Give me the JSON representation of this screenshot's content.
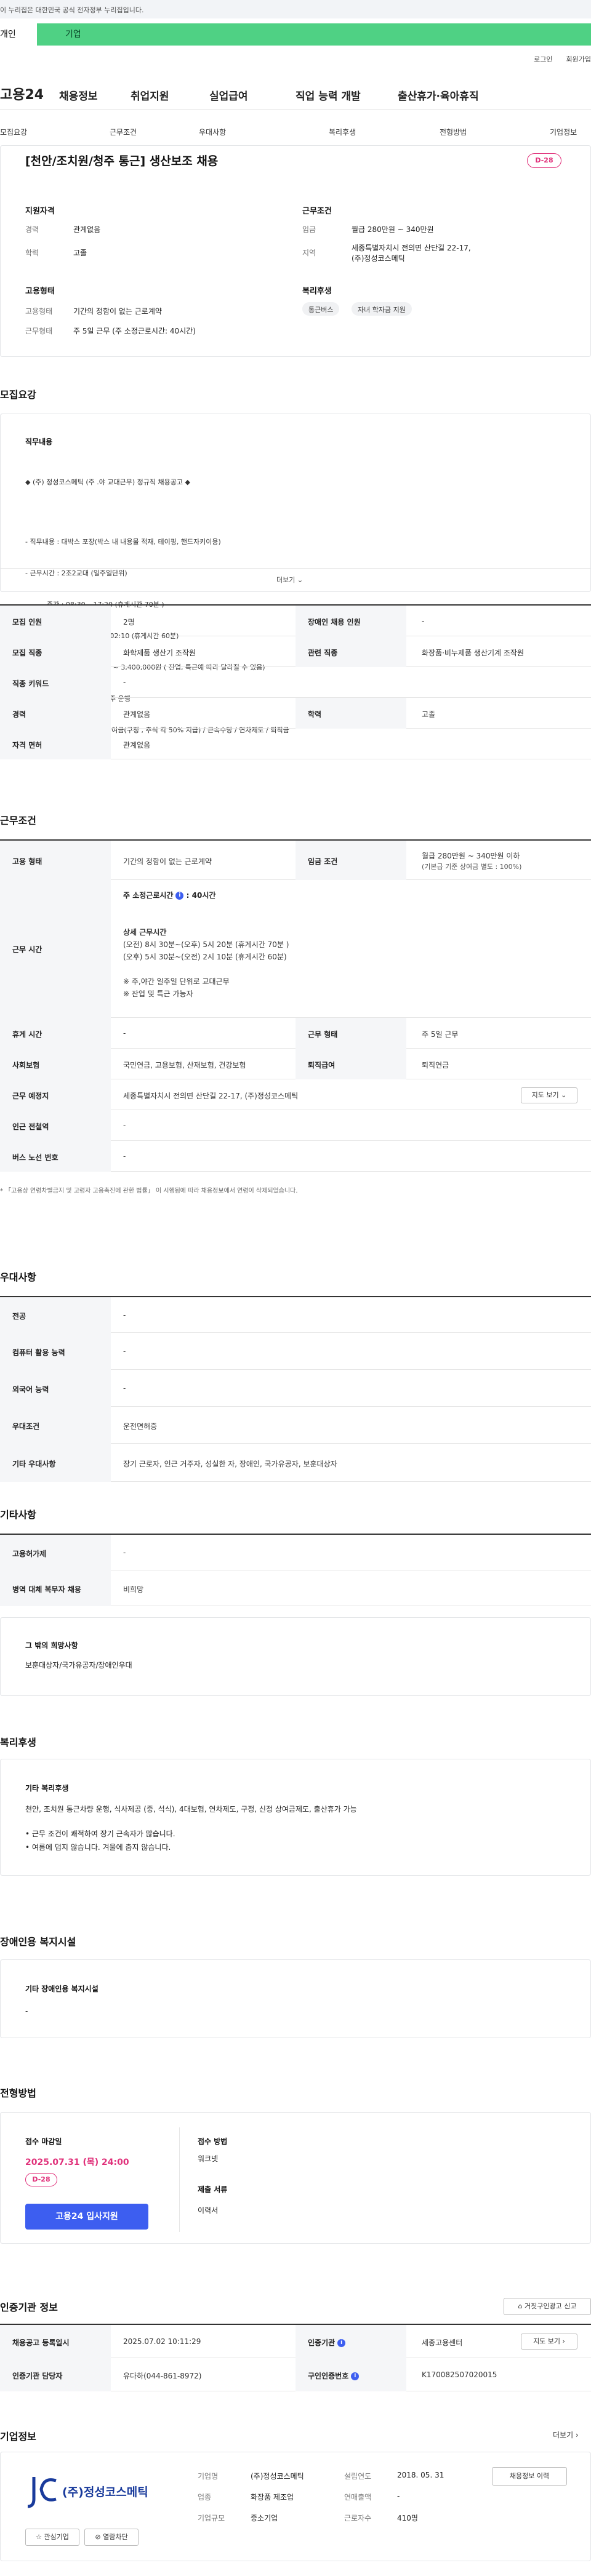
{
  "banner": {
    "text": "이 누리집은 대한민국 공식 전자정부 누리집입니다."
  },
  "user_tabs": [
    "개인",
    "기업"
  ],
  "top_links": [
    "로그인",
    "회원가입"
  ],
  "gnb": {
    "logo": "고용24",
    "items": [
      "채용정보",
      "취업지원",
      "실업급여",
      "직업 능력 개발",
      "출산휴가·육아휴직"
    ]
  },
  "subnav": [
    "모집요강",
    "근무조건",
    "우대사항",
    "복리후생",
    "전형방법",
    "기업정보"
  ],
  "header": {
    "title": "[천안/조치원/청주 통근] 생산보조 채용",
    "dday": "D-28",
    "qualification": {
      "label": "지원자격",
      "rows": [
        {
          "k": "경력",
          "v": "관계없음"
        },
        {
          "k": "학력",
          "v": "고졸"
        }
      ]
    },
    "conditions": {
      "label": "근무조건",
      "rows": [
        {
          "k": "임금",
          "v": "월급 280만원 ~ 340만원"
        },
        {
          "k": "지역",
          "v": "세종특별자치시 전의면 산단길 22-17, (주)정성코스메틱"
        }
      ]
    },
    "employment": {
      "label": "고용형태",
      "rows": [
        {
          "k": "고용형태",
          "v": "기간의 정함이 없는 근로계약"
        },
        {
          "k": "근무형태",
          "v": "주 5일 근무 (주 소정근로시간: 40시간)"
        }
      ]
    },
    "welfare": {
      "label": "복리후생",
      "chips": [
        "통근버스",
        "자녀 학자금 지원"
      ]
    }
  },
  "recruit": {
    "section_title": "모집요강",
    "duty_label": "직무내용",
    "duty_lines": [
      "◆ (주) 정성코스메틱 (주 .야 교대근무) 정규직 채용공고 ◆",
      "- 직무내용 : 대박스 포장(박스 내 내용물 적재, 테이핑, 핸드자키이용)",
      "- 근무시간 : 2조2교대 (일주일단위)",
      "          주간 : 08:30 ~17:20 (휴게시간 70분 )",
      "          야간 : 17:30 ~ 익일 02:10 (휴게시간 60분)",
      "- 급      여 : 월급 2,800,000 ~ 3,400,000원 ( 잔업, 특근에 따라 달라질 수 있음)",
      "- 통근버스 : 천안 , 조치원, 청주 운행",
      "- 복리후생 : 식사제공 / 명절상여금(구정 , 추석 각 50% 지급) / 근속수당 / 연차제도 / 퇴직금"
    ],
    "more": "더보기",
    "table": [
      {
        "th": "모집 인원",
        "td": "2명",
        "th2": "장애인 채용 인원",
        "td2": "-"
      },
      {
        "th": "모집 직종",
        "td": "화학제품 생산기 조작원",
        "th2": "관련 직종",
        "td2": "화장품·비누제품 생산기계 조작원"
      },
      {
        "th": "직종 키워드",
        "td": "-"
      },
      {
        "th": "경력",
        "td": "관계없음",
        "th2": "학력",
        "td2": "고졸"
      },
      {
        "th": "자격 면허",
        "td": "관계없음"
      }
    ]
  },
  "conditions": {
    "section_title": "근무조건",
    "employment_type": {
      "th": "고용 형태",
      "td": "기간의 정함이 없는 근로계약",
      "th2": "임금 조건",
      "td2a": "월급 280만원 ~ 340만원 이하",
      "td2b": "(기본급 기준 상여금 별도 : 100%)"
    },
    "hours": {
      "th": "근무 시간",
      "weekly": "주 소정근로시간",
      "weekly_value": ": 40시간",
      "detail_title": "상세 근무시간",
      "lines": [
        "(오전) 8시 30분~(오후) 5시 20분 (휴게시간 70분 )",
        "(오후) 5시 30분~(오전) 2시 10분 (휴게시간 60분)"
      ],
      "notes": [
        "※ 주,야간 일주일 단위로 교대근무",
        "※ 잔업 및 특근 가능자"
      ]
    },
    "rows": [
      {
        "th": "휴게 시간",
        "td": "-",
        "th2": "근무 형태",
        "td2": "주 5일 근무"
      },
      {
        "th": "사회보험",
        "td": "국민연금, 고용보험, 산재보험, 건강보험",
        "th2": "퇴직급여",
        "td2": "퇴직연금"
      },
      {
        "th": "근무 예정지",
        "td": "세종특별자치시 전의면 산단길 22-17, (주)정성코스메틱",
        "btn": "지도 보기 ⌄"
      },
      {
        "th": "인근 전철역",
        "td": "-"
      },
      {
        "th": "버스 노선 번호",
        "td": "-"
      }
    ],
    "footnote": "* 「고용상 연령차별금지 및 고령자 고용촉진에 관한 법률」 이 시행됨에 따라 채용정보에서 연령이 삭제되었습니다."
  },
  "preference": {
    "section_title": "우대사항",
    "rows": [
      {
        "th": "전공",
        "td": "-"
      },
      {
        "th": "컴퓨터 활용 능력",
        "td": "-"
      },
      {
        "th": "외국어 능력",
        "td": "-"
      },
      {
        "th": "우대조건",
        "td": "운전면허증"
      },
      {
        "th": "기타 우대사항",
        "td": "장기 근로자, 인근 거주자, 성실한 자, 장애인, 국가유공자, 보훈대상자"
      }
    ]
  },
  "other": {
    "section_title": "기타사항",
    "rows": [
      {
        "th": "고용허가제",
        "td": "-"
      },
      {
        "th": "병역 대체 복무자 채용",
        "td": "비희망"
      }
    ],
    "hope_label": "그 밖의 희망사항",
    "hope_text": "보훈대상자/국가유공자/장애인우대"
  },
  "welfare": {
    "section_title": "복리후생",
    "label": "기타 복리후생",
    "text": "천안, 조치원 통근차량 운행, 식사제공 (중, 석식), 4대보험, 연차제도, 구정, 신정 상여금제도, 출산휴가 가능",
    "bullets": [
      "• 근무 조건이 쾌적하여 장기 근속자가 많습니다.",
      "• 여름에 덥지 않습니다. 겨울에 춥지 않습니다."
    ]
  },
  "disability": {
    "section_title": "장애인용 복지시설",
    "label": "기타 장애인용 복지시설",
    "value": "-"
  },
  "process": {
    "section_title": "전형방법",
    "deadline_label": "접수 마감일",
    "deadline": "2025.07.31 (목) 24:00",
    "dday": "D-28",
    "apply_button": "고용24 입사지원",
    "method_label": "접수 방법",
    "method": "워크넷",
    "docs_label": "제출 서류",
    "docs": "이력서"
  },
  "cert": {
    "section_title": "인증기관 정보",
    "report_button": "거짓구인광고 신고",
    "rows": [
      {
        "th": "채용공고 등록일시",
        "td": "2025.07.02 10:11:29",
        "th2": "인증기관",
        "td2": "세종고용센터",
        "btn": "지도 보기 ›"
      },
      {
        "th": "인증기관 담당자",
        "td": "유다하(044-861-8972)",
        "th2": "구인인증번호",
        "td2": "K170082507020015"
      }
    ]
  },
  "company": {
    "section_title": "기업정보",
    "more": "더보기 ›",
    "logo_text": "(주)정성코스메틱",
    "fav_button": "관심기업",
    "hide_button": "열람차단",
    "fields": [
      {
        "k": "기업명",
        "v": "(주)정성코스메틱",
        "k2": "설립연도",
        "v2": "2018. 05. 31"
      },
      {
        "k": "업종",
        "v": "화장품 제조업",
        "k2": "연매출액",
        "v2": "-"
      },
      {
        "k": "기업규모",
        "v": "중소기업",
        "k2": "근로자수",
        "v2": "410명"
      }
    ],
    "jobs_button": "채용정보 이력"
  },
  "colors": {
    "accent": "#3d5ef0",
    "green_tab": "#4fd184",
    "dday": "#e0307a"
  }
}
